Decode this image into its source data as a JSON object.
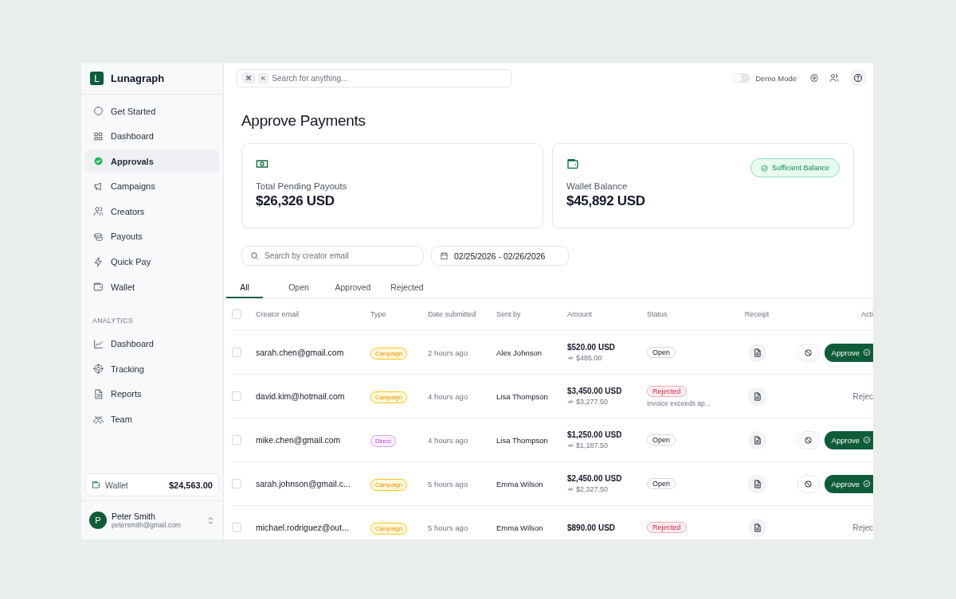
{
  "app": {
    "logo_letter": "L",
    "name": "Lunagraph"
  },
  "sidebar": {
    "items": [
      {
        "label": "Get Started",
        "selected": false
      },
      {
        "label": "Dashboard",
        "selected": false
      },
      {
        "label": "Approvals",
        "selected": true
      },
      {
        "label": "Campaigns",
        "selected": false
      },
      {
        "label": "Creators",
        "selected": false
      },
      {
        "label": "Payouts",
        "selected": false
      },
      {
        "label": "Quick Pay",
        "selected": false
      },
      {
        "label": "Wallet",
        "selected": false
      }
    ],
    "section_title": "ANALYTICS",
    "analytics_items": [
      {
        "label": "Dashboard",
        "selected": false
      },
      {
        "label": "Tracking",
        "selected": false
      },
      {
        "label": "Reports",
        "selected": false
      },
      {
        "label": "Team",
        "selected": false
      }
    ],
    "wallet": {
      "label": "Wallet",
      "amount": "$24,563.00"
    },
    "user": {
      "initial": "P",
      "name": "Peter Smith",
      "email": "petersmith@gmail.com"
    }
  },
  "topbar": {
    "shortcut_keys": [
      "⌘",
      "K"
    ],
    "search_placeholder": "Search for anything...",
    "demo_mode": {
      "label": "Demo Mode",
      "on": false
    }
  },
  "page_title": "Approve Payments",
  "cards": [
    {
      "label": "Total Pending Payouts",
      "value": "$26,326 USD"
    },
    {
      "label": "Wallet Balance",
      "value": "$45,892 USD",
      "badge": "Sufficient Balance"
    }
  ],
  "filters": {
    "search_placeholder": "Search by creator email",
    "date_range": "02/25/2026 - 02/26/2026"
  },
  "tabs": [
    {
      "label": "All",
      "selected": true
    },
    {
      "label": "Open",
      "selected": false
    },
    {
      "label": "Approved",
      "selected": false
    },
    {
      "label": "Rejected",
      "selected": false
    }
  ],
  "table": {
    "all_selected": false,
    "columns": [
      "Creator email",
      "Type",
      "Date submitted",
      "Sent by",
      "Amount",
      "Status",
      "Receipt",
      "Acti"
    ],
    "rows": [
      {
        "selected": false,
        "email": "sarah.chen@gmail.com",
        "type": {
          "label": "Campaign",
          "kind": "campaign"
        },
        "date": "2 hours ago",
        "sent_by": "Alex Johnson",
        "amount": "$520.00 USD",
        "net": "$485.00",
        "status": {
          "label": "Open",
          "kind": "open"
        },
        "action": {
          "kind": "approve",
          "label": "Approve"
        }
      },
      {
        "selected": false,
        "email": "david.kim@hotmail.com",
        "type": {
          "label": "Campaign",
          "kind": "campaign"
        },
        "date": "4 hours ago",
        "sent_by": "Lisa Thompson",
        "amount": "$3,450.00 USD",
        "net": "$3,277.50",
        "status": {
          "label": "Rejected",
          "kind": "rejected",
          "note": "Invoice exceeds ap..."
        },
        "action": {
          "kind": "rejected",
          "label": "Rejec"
        }
      },
      {
        "selected": false,
        "email": "mike.chen@gmail.com",
        "type": {
          "label": "Direct",
          "kind": "direct"
        },
        "date": "4 hours ago",
        "sent_by": "Lisa Thompson",
        "amount": "$1,250.00 USD",
        "net": "$1,187.50",
        "status": {
          "label": "Open",
          "kind": "open"
        },
        "action": {
          "kind": "approve",
          "label": "Approve"
        }
      },
      {
        "selected": false,
        "email": "sarah.johnson@gmail.c...",
        "type": {
          "label": "Campaign",
          "kind": "campaign"
        },
        "date": "5 hours ago",
        "sent_by": "Emma Wilson",
        "amount": "$2,450.00 USD",
        "net": "$2,327.50",
        "status": {
          "label": "Open",
          "kind": "open"
        },
        "action": {
          "kind": "approve",
          "label": "Approve"
        }
      },
      {
        "selected": false,
        "email": "michael.rodriguez@out...",
        "type": {
          "label": "Campaign",
          "kind": "campaign"
        },
        "date": "5 hours ago",
        "sent_by": "Emma Wilson",
        "amount": "$890.00 USD",
        "status": {
          "label": "Rejected",
          "kind": "rejected"
        },
        "action": {
          "kind": "rejected",
          "label": "Rejec"
        }
      }
    ]
  }
}
